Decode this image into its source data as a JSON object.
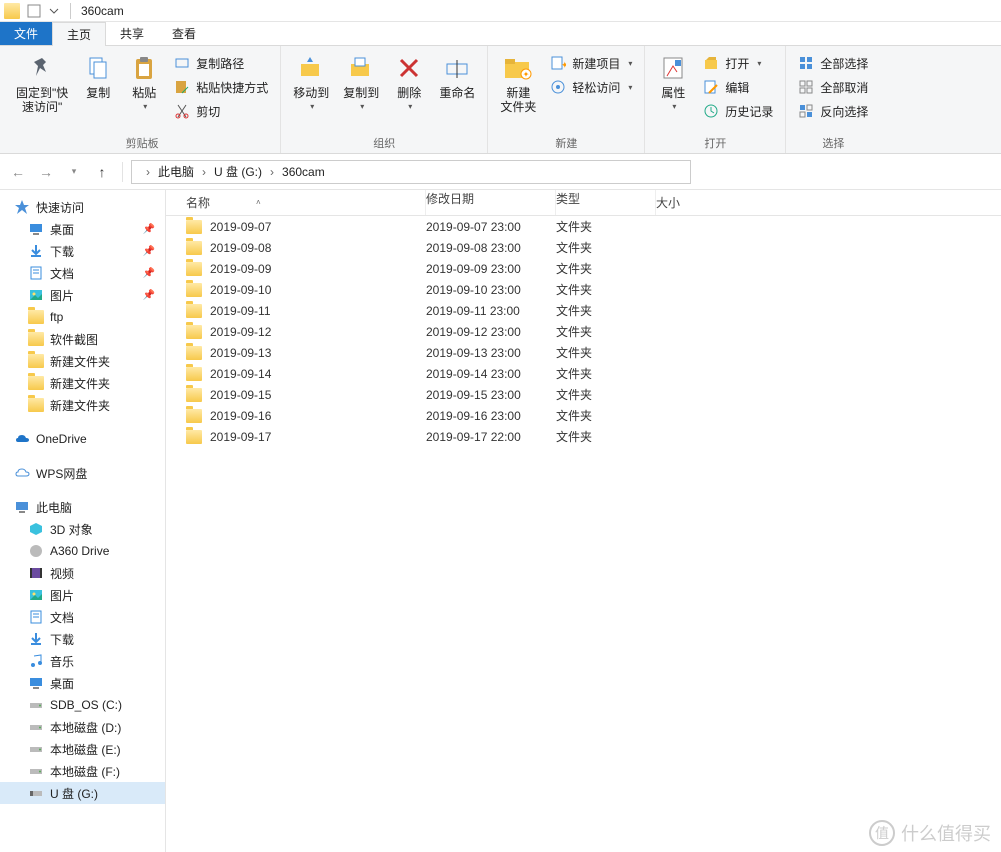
{
  "title": "360cam",
  "tabs": {
    "file": "文件",
    "home": "主页",
    "share": "共享",
    "view": "查看"
  },
  "ribbon": {
    "clipboard": {
      "pin": "固定到\"快\n速访问\"",
      "copy": "复制",
      "paste": "粘贴",
      "copy_path": "复制路径",
      "paste_shortcut": "粘贴快捷方式",
      "cut": "剪切",
      "label": "剪贴板"
    },
    "organize": {
      "move_to": "移动到",
      "copy_to": "复制到",
      "delete": "删除",
      "rename": "重命名",
      "label": "组织"
    },
    "new": {
      "new_folder": "新建\n文件夹",
      "new_item": "新建项目",
      "easy_access": "轻松访问",
      "label": "新建"
    },
    "open": {
      "properties": "属性",
      "open": "打开",
      "edit": "编辑",
      "history": "历史记录",
      "label": "打开"
    },
    "select": {
      "select_all": "全部选择",
      "select_none": "全部取消",
      "invert": "反向选择",
      "label": "选择"
    }
  },
  "breadcrumbs": [
    "此电脑",
    "U 盘 (G:)",
    "360cam"
  ],
  "tree": {
    "quick_access": "快速访问",
    "quick_items": [
      {
        "label": "桌面",
        "icon": "desktop",
        "pinned": true
      },
      {
        "label": "下载",
        "icon": "download",
        "pinned": true
      },
      {
        "label": "文档",
        "icon": "document",
        "pinned": true
      },
      {
        "label": "图片",
        "icon": "picture",
        "pinned": true
      },
      {
        "label": "ftp",
        "icon": "folder"
      },
      {
        "label": "软件截图",
        "icon": "folder"
      },
      {
        "label": "新建文件夹",
        "icon": "folder"
      },
      {
        "label": "新建文件夹",
        "icon": "folder"
      },
      {
        "label": "新建文件夹",
        "icon": "folder"
      }
    ],
    "onedrive": "OneDrive",
    "wps": "WPS网盘",
    "this_pc": "此电脑",
    "pc_items": [
      {
        "label": "3D 对象",
        "icon": "3d"
      },
      {
        "label": "A360 Drive",
        "icon": "a360"
      },
      {
        "label": "视频",
        "icon": "video"
      },
      {
        "label": "图片",
        "icon": "picture"
      },
      {
        "label": "文档",
        "icon": "document"
      },
      {
        "label": "下载",
        "icon": "download"
      },
      {
        "label": "音乐",
        "icon": "music"
      },
      {
        "label": "桌面",
        "icon": "desktop"
      },
      {
        "label": "SDB_OS (C:)",
        "icon": "drive"
      },
      {
        "label": "本地磁盘 (D:)",
        "icon": "drive"
      },
      {
        "label": "本地磁盘 (E:)",
        "icon": "drive"
      },
      {
        "label": "本地磁盘 (F:)",
        "icon": "drive"
      },
      {
        "label": "U 盘 (G:)",
        "icon": "usb",
        "selected": true
      }
    ]
  },
  "columns": {
    "name": "名称",
    "date": "修改日期",
    "type": "类型",
    "size": "大小"
  },
  "rows": [
    {
      "name": "2019-09-07",
      "date": "2019-09-07 23:00",
      "type": "文件夹"
    },
    {
      "name": "2019-09-08",
      "date": "2019-09-08 23:00",
      "type": "文件夹"
    },
    {
      "name": "2019-09-09",
      "date": "2019-09-09 23:00",
      "type": "文件夹"
    },
    {
      "name": "2019-09-10",
      "date": "2019-09-10 23:00",
      "type": "文件夹"
    },
    {
      "name": "2019-09-11",
      "date": "2019-09-11 23:00",
      "type": "文件夹"
    },
    {
      "name": "2019-09-12",
      "date": "2019-09-12 23:00",
      "type": "文件夹"
    },
    {
      "name": "2019-09-13",
      "date": "2019-09-13 23:00",
      "type": "文件夹"
    },
    {
      "name": "2019-09-14",
      "date": "2019-09-14 23:00",
      "type": "文件夹"
    },
    {
      "name": "2019-09-15",
      "date": "2019-09-15 23:00",
      "type": "文件夹"
    },
    {
      "name": "2019-09-16",
      "date": "2019-09-16 23:00",
      "type": "文件夹"
    },
    {
      "name": "2019-09-17",
      "date": "2019-09-17 22:00",
      "type": "文件夹"
    }
  ],
  "watermark": "什么值得买"
}
